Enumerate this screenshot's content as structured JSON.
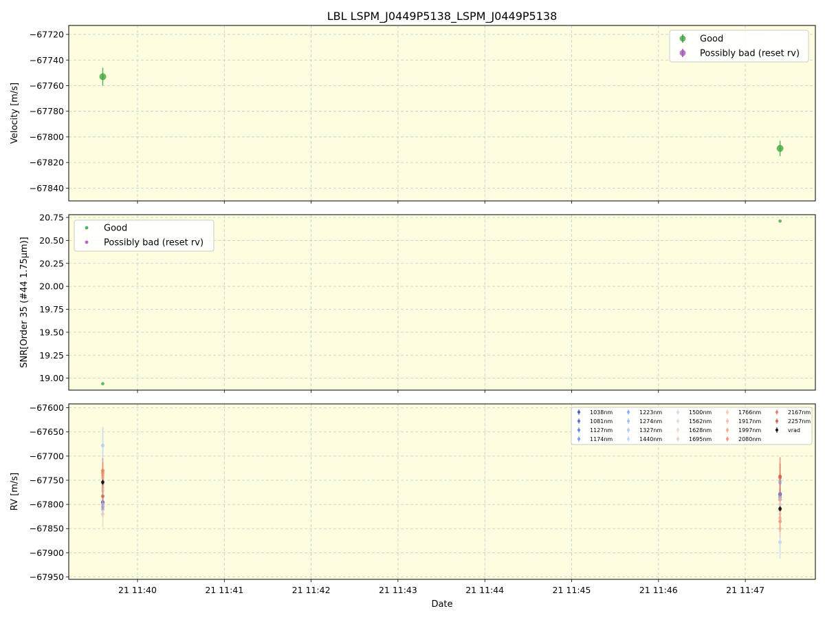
{
  "colors": {
    "plot_background": "#fdfde0",
    "grid": "#c8c8c8",
    "good": "#3aa03a",
    "bad": "#a050b0",
    "vrad": "#000000"
  },
  "chart_data": [
    {
      "type": "scatter",
      "title": "LBL LSPM_J0449P5138_LSPM_J0449P5138",
      "ylabel": "Velocity [m/s]",
      "ylim": [
        -67850,
        -67713
      ],
      "yticks": [
        -67720,
        -67740,
        -67760,
        -67780,
        -67800,
        -67820,
        -67840
      ],
      "grid": true,
      "legend_placement": "top-right",
      "legend": [
        "Good",
        "Possibly bad (reset rv)"
      ],
      "series": [
        {
          "name": "Good",
          "color": "#3aa03a",
          "error_bars": true,
          "points": [
            {
              "x": "11:39:36",
              "y": -67753,
              "err": 7
            },
            {
              "x": "11:47:24",
              "y": -67809,
              "err": 6
            }
          ]
        },
        {
          "name": "Possibly bad (reset rv)",
          "color": "#a050b0",
          "points": []
        }
      ]
    },
    {
      "type": "scatter",
      "ylabel": "SNR[Order 35 (#44 1.75μm)]",
      "ylim": [
        18.87,
        20.78
      ],
      "yticks": [
        "19.00",
        "19.25",
        "19.50",
        "19.75",
        "20.00",
        "20.25",
        "20.50",
        "20.75"
      ],
      "grid": true,
      "legend_placement": "top-left",
      "legend": [
        "Good",
        "Possibly bad (reset rv)"
      ],
      "series": [
        {
          "name": "Good",
          "color": "#3aa03a",
          "points": [
            {
              "x": "11:39:36",
              "y": 18.94
            },
            {
              "x": "11:47:24",
              "y": 20.71
            }
          ]
        },
        {
          "name": "Possibly bad (reset rv)",
          "color": "#a050b0",
          "points": []
        }
      ]
    },
    {
      "type": "scatter",
      "xlabel": "Date",
      "ylabel": "RV [m/s]",
      "ylim": [
        -67955,
        -67592
      ],
      "yticks": [
        -67600,
        -67650,
        -67700,
        -67750,
        -67800,
        -67850,
        -67900,
        -67950
      ],
      "xticks": [
        "21 11:40",
        "21 11:41",
        "21 11:42",
        "21 11:43",
        "21 11:44",
        "21 11:45",
        "21 11:46",
        "21 11:47"
      ],
      "grid": true,
      "legend_placement": "top-right",
      "series": [
        {
          "name": "1038nm",
          "color": "#3b4cc0",
          "points": [
            {
              "x": "11:39:36",
              "y": -67795,
              "err": 12
            },
            {
              "x": "11:47:24",
              "y": -67778,
              "err": 10
            }
          ]
        },
        {
          "name": "1081nm",
          "color": "#4a63d3",
          "points": [
            {
              "x": "11:39:36",
              "y": -67796,
              "err": 12
            },
            {
              "x": "11:47:24",
              "y": -67780,
              "err": 10
            }
          ]
        },
        {
          "name": "1127nm",
          "color": "#5d7ce6",
          "points": [
            {
              "x": "11:39:36",
              "y": -67797,
              "err": 13
            },
            {
              "x": "11:47:24",
              "y": -67779,
              "err": 11
            }
          ]
        },
        {
          "name": "1174nm",
          "color": "#6f92f3",
          "points": [
            {
              "x": "11:39:36",
              "y": -67800,
              "err": 14
            },
            {
              "x": "11:47:24",
              "y": -67785,
              "err": 12
            }
          ]
        },
        {
          "name": "1223nm",
          "color": "#82a6fb",
          "points": [
            {
              "x": "11:39:36",
              "y": -67805,
              "err": 15
            },
            {
              "x": "11:47:24",
              "y": -67790,
              "err": 14
            }
          ]
        },
        {
          "name": "1274nm",
          "color": "#96b7ff",
          "points": [
            {
              "x": "11:39:36",
              "y": -67810,
              "err": 16
            },
            {
              "x": "11:47:24",
              "y": -67755,
              "err": 15
            }
          ]
        },
        {
          "name": "1327nm",
          "color": "#a9c6fd",
          "points": [
            {
              "x": "11:39:36",
              "y": -67678,
              "err": 38
            },
            {
              "x": "11:47:24",
              "y": -67752,
              "err": 16
            }
          ]
        },
        {
          "name": "1440nm",
          "color": "#bbd1f8",
          "points": [
            {
              "x": "11:39:36",
              "y": -67800,
              "err": 20
            },
            {
              "x": "11:47:24",
              "y": -67878,
              "err": 34
            }
          ]
        },
        {
          "name": "1500nm",
          "color": "#cbd8ee",
          "points": [
            {
              "x": "11:39:36",
              "y": -67772,
              "err": 18
            },
            {
              "x": "11:47:24",
              "y": -67800,
              "err": 16
            }
          ]
        },
        {
          "name": "1562nm",
          "color": "#d9dce1",
          "points": [
            {
              "x": "11:39:36",
              "y": -67760,
              "err": 15
            },
            {
              "x": "11:47:24",
              "y": -67808,
              "err": 14
            }
          ]
        },
        {
          "name": "1628nm",
          "color": "#e3d9d3",
          "points": [
            {
              "x": "11:39:36",
              "y": -67770,
              "err": 17
            },
            {
              "x": "11:47:24",
              "y": -67820,
              "err": 15
            }
          ]
        },
        {
          "name": "1695nm",
          "color": "#eacfc1",
          "points": [
            {
              "x": "11:39:36",
              "y": -67765,
              "err": 16
            },
            {
              "x": "11:47:24",
              "y": -67812,
              "err": 15
            }
          ]
        },
        {
          "name": "1766nm",
          "color": "#f1c4b0",
          "points": [
            {
              "x": "11:39:36",
              "y": -67820,
              "err": 28
            },
            {
              "x": "11:47:24",
              "y": -67850,
              "err": 20
            }
          ]
        },
        {
          "name": "1917nm",
          "color": "#f5b79c",
          "points": [
            {
              "x": "11:39:36",
              "y": -67745,
              "err": 20
            },
            {
              "x": "11:47:24",
              "y": -67828,
              "err": 20
            }
          ]
        },
        {
          "name": "1997nm",
          "color": "#f4a585",
          "points": [
            {
              "x": "11:39:36",
              "y": -67740,
              "err": 22
            },
            {
              "x": "11:47:24",
              "y": -67790,
              "err": 20
            }
          ]
        },
        {
          "name": "2080nm",
          "color": "#ef9070",
          "points": [
            {
              "x": "11:39:36",
              "y": -67735,
              "err": 22
            },
            {
              "x": "11:47:24",
              "y": -67835,
              "err": 22
            }
          ]
        },
        {
          "name": "2167nm",
          "color": "#e47a5e",
          "points": [
            {
              "x": "11:39:36",
              "y": -67730,
              "err": 26
            },
            {
              "x": "11:47:24",
              "y": -67745,
              "err": 30
            }
          ]
        },
        {
          "name": "2257nm",
          "color": "#cf5a4c",
          "points": [
            {
              "x": "11:39:36",
              "y": -67783,
              "err": 28
            },
            {
              "x": "11:47:24",
              "y": -67742,
              "err": 40
            }
          ]
        },
        {
          "name": "vrad",
          "color": "#000000",
          "points": [
            {
              "x": "11:39:36",
              "y": -67754,
              "err": 5
            },
            {
              "x": "11:47:24",
              "y": -67809,
              "err": 5
            }
          ]
        }
      ]
    }
  ]
}
